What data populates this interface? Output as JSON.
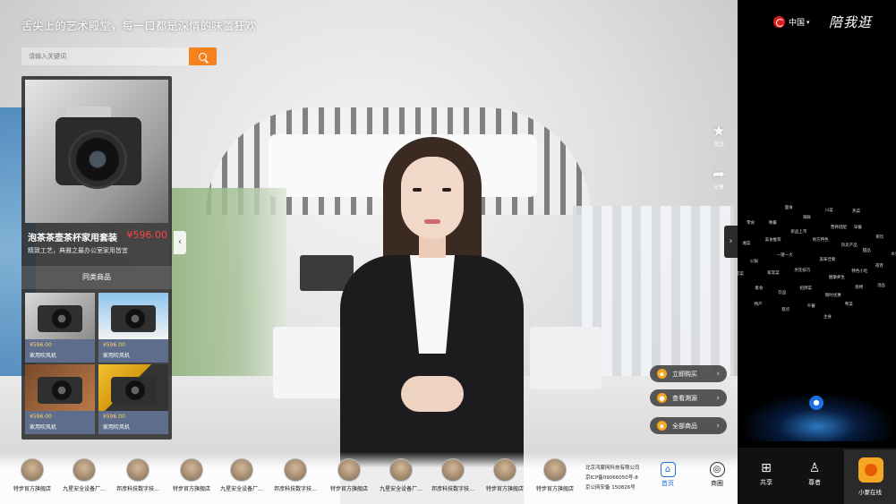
{
  "slogan": "舌尖上的艺术殿堂，每一口都是深情的味蕾狂欢",
  "search": {
    "placeholder": "请输入关键词"
  },
  "product": {
    "title": "泡茶茶壶茶杯家用套装",
    "price": "¥596.00",
    "description": "精致工艺，典雅之最办公室家用皆宜",
    "similar_header": "同类商品",
    "similar": [
      {
        "price": "¥596.00",
        "name": "家用吹风机"
      },
      {
        "price": "¥596.00",
        "name": "家用吹风机"
      },
      {
        "price": "¥596.00",
        "name": "家用吹风机"
      },
      {
        "price": "¥596.00",
        "name": "家用吹风机"
      }
    ]
  },
  "float_actions": [
    {
      "icon": "star-icon",
      "label": "关注"
    },
    {
      "icon": "share-icon",
      "label": "分享"
    }
  ],
  "actions": [
    {
      "icon": "cart-icon",
      "label": "立即购买"
    },
    {
      "icon": "trace-icon",
      "label": "查看溯源"
    },
    {
      "icon": "bag-icon",
      "label": "全部商品"
    }
  ],
  "stores": [
    "特步官方旗舰店",
    "九星安全设备厂...",
    "邦彦科技数字技...",
    "特步官方旗舰店",
    "九星安全设备厂...",
    "邦彦科技数字技...",
    "特步官方旗舰店",
    "九星安全设备厂...",
    "邦彦科技数字技...",
    "特步官方旗舰店",
    "特步官方旗舰店"
  ],
  "company": {
    "name": "北京鸿蒙网科技有限公司",
    "icp": "京ICP备09066050号-8",
    "police": "京公网安备 150826号"
  },
  "nav": [
    {
      "icon": "home-icon",
      "label": "首页"
    },
    {
      "icon": "mall-icon",
      "label": "商圈"
    }
  ],
  "region": "中国",
  "brand": "陪我逛",
  "word_cloud": [
    "美味佳肴",
    "烹饪技巧",
    "地方特色",
    "健康养生",
    "一键一大",
    "热卖产品",
    "招牌菜",
    "新品上市",
    "特色小吃",
    "家常菜",
    "营养搭配",
    "限时优惠",
    "美食推荐",
    "甜品",
    "饮品",
    "海鲜",
    "烧烤",
    "火锅",
    "早餐",
    "午餐",
    "晚餐",
    "夜宵",
    "素食",
    "川菜",
    "粤菜",
    "湘菜",
    "茶饮",
    "糕点",
    "面食",
    "汤品",
    "凉菜",
    "热菜",
    "主食",
    "零食",
    "水果",
    "特产"
  ],
  "right_buttons": [
    {
      "icon": "plus-square-icon",
      "label": "共享"
    },
    {
      "icon": "user-icon",
      "label": "尊者"
    }
  ],
  "assistant": {
    "label": "小蒙在线"
  },
  "colors": {
    "accent": "#f5821f",
    "price": "#ff4242",
    "mic": "#1f6fe0",
    "assistant": "#f5a623"
  }
}
